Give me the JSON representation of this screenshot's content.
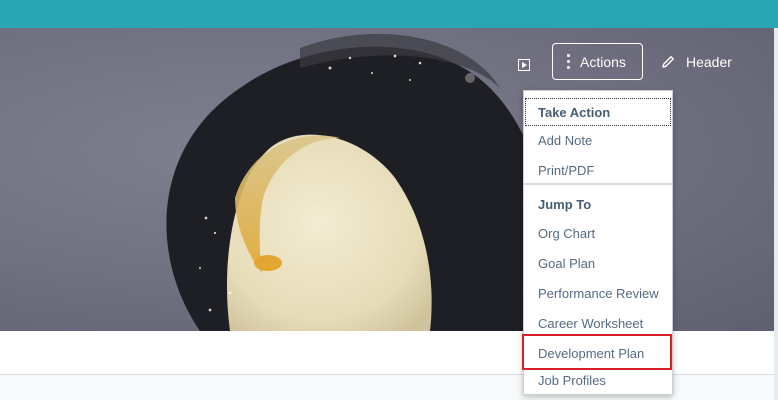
{
  "toolbar": {
    "actions_label": "Actions",
    "header_label": "Header",
    "icons": {
      "play": "play-box-icon",
      "more": "vertical-dots-icon",
      "edit": "pencil-icon"
    }
  },
  "menu": {
    "take_action": {
      "heading": "Take Action",
      "items": [
        "Add Note",
        "Print/PDF"
      ]
    },
    "jump_to": {
      "heading": "Jump To",
      "items": [
        "Org Chart",
        "Goal Plan",
        "Performance Review",
        "Career Worksheet",
        "Development Plan",
        "Job Profiles"
      ]
    },
    "highlighted_item": "Development Plan"
  },
  "colors": {
    "topbar": "#2aa6b3",
    "menu_text": "#556b82",
    "highlight_border": "#d8202a"
  }
}
